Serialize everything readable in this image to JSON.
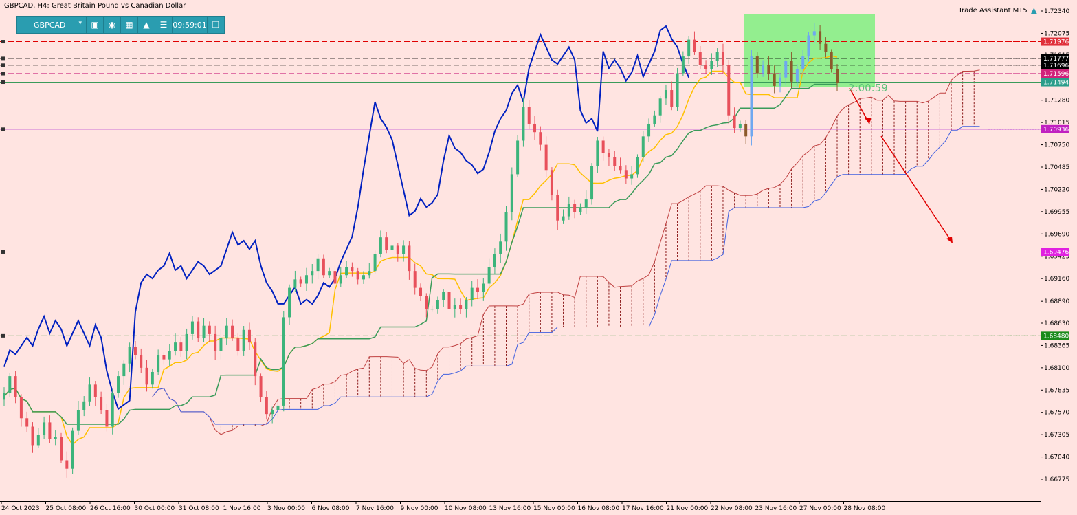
{
  "header": {
    "title": "GBPCAD, H4:  Great Britain Pound vs Canadian Dollar",
    "assistant_label": "Trade Assistant MT5"
  },
  "toolbar": {
    "symbol": "GBPCAD",
    "time": "09:59:01",
    "icons": [
      "camera-icon",
      "eye-icon",
      "calendar-icon",
      "alert-icon",
      "menu-icon",
      "window-icon"
    ]
  },
  "timer_text": "2:00:59",
  "colors": {
    "background": "#ffe4e1",
    "bull": "#3cb47b",
    "bear": "#e8505b",
    "tenkan": "#ffc000",
    "kijun": "#3a9b5a",
    "chikou": "#0020c0",
    "cloud": "#8b1a1a",
    "box": "#80f080",
    "arrow": "#e00000"
  },
  "chart_data": {
    "type": "candlestick",
    "y_ticks": [
      "1.72340",
      "1.72075",
      "1.71815",
      "1.71550",
      "1.71280",
      "1.71015",
      "1.70750",
      "1.70485",
      "1.70220",
      "1.69955",
      "1.69690",
      "1.69425",
      "1.69160",
      "1.68890",
      "1.68630",
      "1.68365",
      "1.68100",
      "1.67835",
      "1.67570",
      "1.67305",
      "1.67040",
      "1.66775"
    ],
    "x_labels": [
      "24 Oct 2023",
      "25 Oct 08:00",
      "26 Oct 16:00",
      "30 Oct 00:00",
      "31 Oct 08:00",
      "1 Nov 16:00",
      "3 Nov 00:00",
      "6 Nov 08:00",
      "7 Nov 16:00",
      "9 Nov 00:00",
      "10 Nov 08:00",
      "13 Nov 16:00",
      "15 Nov 00:00",
      "16 Nov 08:00",
      "17 Nov 16:00",
      "21 Nov 00:00",
      "22 Nov 08:00",
      "23 Nov 16:00",
      "27 Nov 00:00",
      "28 Nov 08:00"
    ],
    "ylim": [
      1.6655,
      1.7243
    ],
    "levels": [
      {
        "price": 1.71976,
        "label": "1.71976",
        "color": "#e00000",
        "style": "dashed",
        "tag_bg": "#e0303a"
      },
      {
        "price": 1.71777,
        "label": "1.71777",
        "color": "#000000",
        "style": "dashed",
        "tag_bg": "#000000"
      },
      {
        "price": 1.71696,
        "label": "1.71696",
        "color": "#000000",
        "style": "dashed",
        "tag_bg": "#000000"
      },
      {
        "price": 1.71596,
        "label": "1.71596",
        "color": "#c0006a",
        "style": "dashed",
        "tag_bg": "#d0207a"
      },
      {
        "price": 1.71494,
        "label": "1.71494",
        "color": "#3a9b5a",
        "style": "solid",
        "tag_bg": "#2a9d8a"
      },
      {
        "price": 1.70936,
        "label": "1.70936",
        "color": "#9a00d0",
        "style": "solid",
        "tag_bg": "#c020c0"
      },
      {
        "price": 1.69476,
        "label": "1.69476",
        "color": "#e000e0",
        "style": "dashed",
        "tag_bg": "#e020e0"
      },
      {
        "price": 1.6848,
        "label": "1.68480",
        "color": "#1a8a1a",
        "style": "dashed",
        "tag_bg": "#1a8a1a"
      }
    ],
    "candles_close_path": [
      1.678,
      1.68,
      1.6775,
      1.675,
      1.674,
      1.6718,
      1.673,
      1.6745,
      1.6725,
      1.6728,
      1.67,
      1.669,
      1.6735,
      1.676,
      1.677,
      1.679,
      1.6775,
      1.676,
      1.674,
      1.678,
      1.68,
      1.6815,
      1.6835,
      1.6825,
      1.681,
      1.679,
      1.6805,
      1.6825,
      1.682,
      1.683,
      1.684,
      1.683,
      1.685,
      1.6865,
      1.6845,
      1.686,
      1.685,
      1.683,
      1.6845,
      1.686,
      1.6845,
      1.683,
      1.6855,
      1.684,
      1.68,
      1.6775,
      1.6755,
      1.676,
      1.6765,
      1.687,
      1.6905,
      1.6915,
      1.691,
      1.692,
      1.6925,
      1.694,
      1.692,
      1.6925,
      1.691,
      1.692,
      1.693,
      1.6925,
      1.6915,
      1.692,
      1.6925,
      1.6945,
      1.6965,
      1.695,
      1.6955,
      1.6945,
      1.6955,
      1.6925,
      1.6905,
      1.6895,
      1.688,
      1.688,
      1.689,
      1.69,
      1.688,
      1.6885,
      1.688,
      1.689,
      1.6905,
      1.69,
      1.691,
      1.693,
      1.6945,
      1.696,
      1.6995,
      1.704,
      1.708,
      1.712,
      1.71,
      1.709,
      1.7075,
      1.7045,
      1.7015,
      1.6985,
      1.699,
      1.7005,
      1.6995,
      1.7,
      1.701,
      1.705,
      1.708,
      1.7065,
      1.706,
      1.705,
      1.7045,
      1.7035,
      1.704,
      1.706,
      1.7085,
      1.71,
      1.711,
      1.713,
      1.714,
      1.712,
      1.716,
      1.718,
      1.72,
      1.7185,
      1.717,
      1.7165,
      1.7175,
      1.7185,
      1.717,
      1.711,
      1.7095,
      1.71,
      1.7085,
      1.718,
      1.716,
      1.717,
      1.716,
      1.7145,
      1.7155,
      1.7175,
      1.715,
      1.7165,
      1.718,
      1.7205,
      1.721,
      1.7195,
      1.7185,
      1.7165,
      1.7149
    ]
  }
}
